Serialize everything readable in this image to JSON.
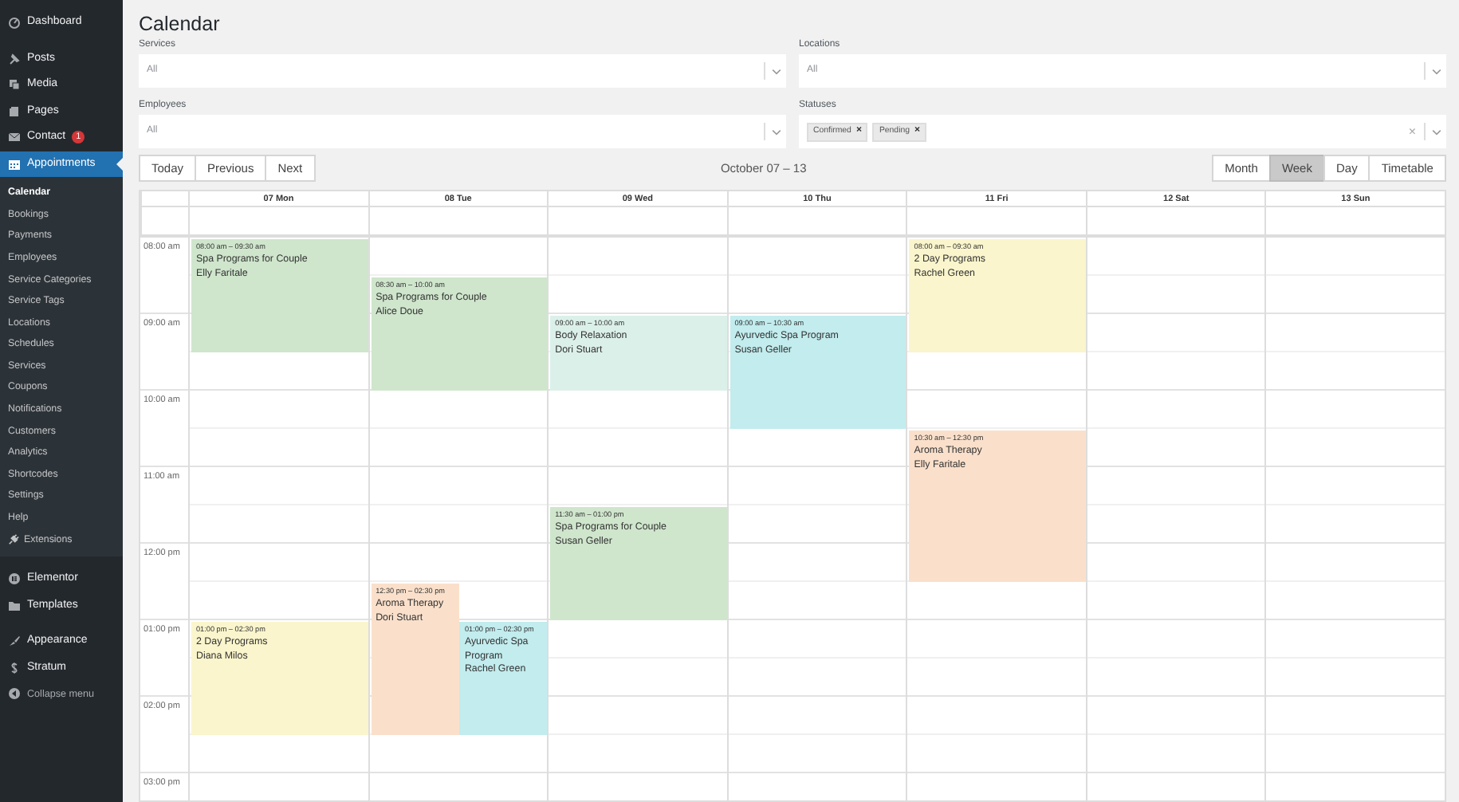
{
  "sidebar": {
    "sections": [
      {
        "items": [
          {
            "label": "Dashboard",
            "kind": "menu",
            "selected": false
          }
        ]
      },
      {
        "items": [
          {
            "label": "Posts",
            "kind": "menu",
            "selected": false
          },
          {
            "label": "Media",
            "kind": "menu",
            "selected": false
          },
          {
            "label": "Pages",
            "kind": "menu",
            "selected": false
          },
          {
            "label": "Contact",
            "kind": "menu",
            "selected": false,
            "badge": "1"
          },
          {
            "label": "Appointments",
            "kind": "menu",
            "selected": true,
            "children": [
              {
                "label": "Calendar",
                "selected": true
              },
              {
                "label": "Bookings",
                "selected": false
              },
              {
                "label": "Payments",
                "selected": false
              },
              {
                "label": "Employees",
                "selected": false
              },
              {
                "label": "Service Categories",
                "selected": false
              },
              {
                "label": "Service Tags",
                "selected": false
              },
              {
                "label": "Locations",
                "selected": false
              },
              {
                "label": "Schedules",
                "selected": false
              },
              {
                "label": "Services",
                "selected": false
              },
              {
                "label": "Coupons",
                "selected": false
              },
              {
                "label": "Notifications",
                "selected": false
              },
              {
                "label": "Customers",
                "selected": false
              },
              {
                "label": "Analytics",
                "selected": false
              },
              {
                "label": "Shortcodes",
                "selected": false
              },
              {
                "label": "Settings",
                "selected": false
              },
              {
                "label": "Help",
                "selected": false
              },
              {
                "label": "Extensions",
                "selected": false,
                "kind": "iconed"
              }
            ]
          }
        ]
      },
      {
        "items": [
          {
            "label": "Elementor",
            "kind": "menu",
            "selected": false
          },
          {
            "label": "Templates",
            "kind": "menu",
            "selected": false
          }
        ]
      },
      {
        "items": [
          {
            "label": "Appearance",
            "kind": "menu",
            "selected": false
          },
          {
            "label": "Stratum",
            "kind": "menu",
            "selected": false
          },
          {
            "label": "Collapse menu",
            "kind": "collapse",
            "selected": false
          }
        ]
      }
    ]
  },
  "page": {
    "title": "Calendar"
  },
  "filters": [
    {
      "label": "Services",
      "value": "All"
    },
    {
      "label": "Locations",
      "value": "All"
    },
    {
      "label": "Employees",
      "value": "All"
    },
    {
      "label": "Statuses",
      "tags": [
        {
          "label": "Confirmed",
          "remove": "×"
        },
        {
          "label": "Pending",
          "remove": "×"
        }
      ],
      "clear": "×"
    }
  ],
  "toolbar": {
    "nav_buttons": [
      "Today",
      "Previous",
      "Next"
    ],
    "range": "October 07 – 13",
    "views": [
      {
        "label": "Month",
        "selected": false
      },
      {
        "label": "Week",
        "selected": true
      },
      {
        "label": "Day",
        "selected": false
      },
      {
        "label": "Timetable",
        "selected": false
      }
    ]
  },
  "calendar": {
    "times": [
      "08:00 am",
      "09:00 am",
      "10:00 am",
      "11:00 am",
      "12:00 pm",
      "01:00 pm",
      "02:00 pm",
      "03:00 pm"
    ],
    "days": [
      {
        "label": "07 Mon",
        "events": [
          {
            "time": "08:00 am – 09:30 am",
            "title": "Spa Programs for Couple",
            "client": "Elly Faritale",
            "color": "#cfe6cc"
          },
          {
            "time": "01:00 pm – 02:30 pm",
            "title": "2 Day Programs",
            "client": "Diana Milos",
            "color": "#faf5cc"
          }
        ]
      },
      {
        "label": "08 Tue",
        "events": [
          {
            "time": "08:30 am – 10:00 am",
            "title": "Spa Programs for Couple",
            "client": "Alice Doue",
            "color": "#cfe6cc"
          },
          {
            "time": "12:30 pm – 02:30 pm",
            "title": "Aroma Therapy",
            "client": "Dori Stuart",
            "color": "#fae0cb"
          },
          {
            "time": "01:00 pm – 02:30 pm",
            "title": "Ayurvedic Spa Program",
            "client": "Rachel Green",
            "color": "#c2ecee"
          }
        ]
      },
      {
        "label": "09 Wed",
        "events": [
          {
            "time": "09:00 am – 10:00 am",
            "title": "Body Relaxation",
            "client": "Dori Stuart",
            "color": "#dcf0ea"
          },
          {
            "time": "11:30 am – 01:00 pm",
            "title": "Spa Programs for Couple",
            "client": "Susan Geller",
            "color": "#cfe6cc"
          }
        ]
      },
      {
        "label": "10 Thu",
        "events": [
          {
            "time": "09:00 am – 10:30 am",
            "title": "Ayurvedic Spa Program",
            "client": "Susan Geller",
            "color": "#c2ecee"
          }
        ]
      },
      {
        "label": "11 Fri",
        "events": [
          {
            "time": "08:00 am – 09:30 am",
            "title": "2 Day Programs",
            "client": "Rachel Green",
            "color": "#faf5cc"
          },
          {
            "time": "10:30 am – 12:30 pm",
            "title": "Aroma Therapy",
            "client": "Elly Faritale",
            "color": "#fae0cb"
          }
        ]
      },
      {
        "label": "12 Sat"
      },
      {
        "label": "13 Sun"
      }
    ]
  }
}
